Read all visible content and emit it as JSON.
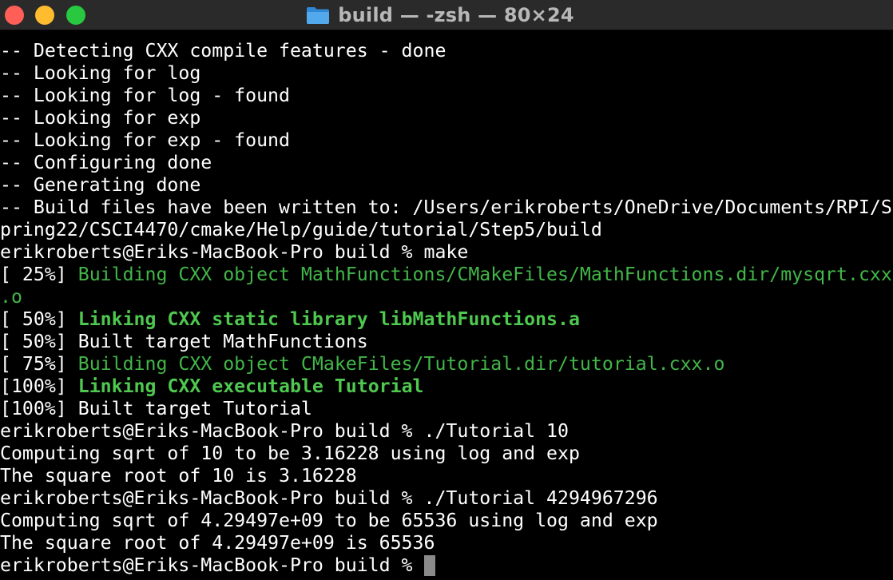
{
  "window": {
    "title": "build — -zsh — 80×24",
    "folder_icon": "folder-icon"
  },
  "colors": {
    "close": "#ff5f57",
    "minimize": "#febc2e",
    "zoom": "#28c840",
    "green": "#42b648",
    "background": "#000000",
    "text": "#ffffff"
  },
  "terminal": {
    "lines": [
      {
        "segments": [
          {
            "text": "-- Detecting CXX compile features - done",
            "style": "normal"
          }
        ]
      },
      {
        "segments": [
          {
            "text": "-- Looking for log",
            "style": "normal"
          }
        ]
      },
      {
        "segments": [
          {
            "text": "-- Looking for log - found",
            "style": "normal"
          }
        ]
      },
      {
        "segments": [
          {
            "text": "-- Looking for exp",
            "style": "normal"
          }
        ]
      },
      {
        "segments": [
          {
            "text": "-- Looking for exp - found",
            "style": "normal"
          }
        ]
      },
      {
        "segments": [
          {
            "text": "-- Configuring done",
            "style": "normal"
          }
        ]
      },
      {
        "segments": [
          {
            "text": "-- Generating done",
            "style": "normal"
          }
        ]
      },
      {
        "segments": [
          {
            "text": "-- Build files have been written to: /Users/erikroberts/OneDrive/Documents/RPI/S",
            "style": "normal"
          }
        ]
      },
      {
        "segments": [
          {
            "text": "pring22/CSCI4470/cmake/Help/guide/tutorial/Step5/build",
            "style": "normal"
          }
        ]
      },
      {
        "segments": [
          {
            "text": "erikroberts@Eriks-MacBook-Pro build % make",
            "style": "normal"
          }
        ]
      },
      {
        "segments": [
          {
            "text": "[ 25%] ",
            "style": "normal"
          },
          {
            "text": "Building CXX object MathFunctions/CMakeFiles/MathFunctions.dir/mysqrt.cxx",
            "style": "green"
          }
        ]
      },
      {
        "segments": [
          {
            "text": ".o",
            "style": "green"
          }
        ]
      },
      {
        "segments": [
          {
            "text": "[ 50%] ",
            "style": "normal"
          },
          {
            "text": "Linking CXX static library libMathFunctions.a",
            "style": "green-bold"
          }
        ]
      },
      {
        "segments": [
          {
            "text": "[ 50%] Built target MathFunctions",
            "style": "normal"
          }
        ]
      },
      {
        "segments": [
          {
            "text": "[ 75%] ",
            "style": "normal"
          },
          {
            "text": "Building CXX object CMakeFiles/Tutorial.dir/tutorial.cxx.o",
            "style": "green"
          }
        ]
      },
      {
        "segments": [
          {
            "text": "[100%] ",
            "style": "normal"
          },
          {
            "text": "Linking CXX executable Tutorial",
            "style": "green-bold"
          }
        ]
      },
      {
        "segments": [
          {
            "text": "[100%] Built target Tutorial",
            "style": "normal"
          }
        ]
      },
      {
        "segments": [
          {
            "text": "erikroberts@Eriks-MacBook-Pro build % ./Tutorial 10",
            "style": "normal"
          }
        ]
      },
      {
        "segments": [
          {
            "text": "Computing sqrt of 10 to be 3.16228 using log and exp",
            "style": "normal"
          }
        ]
      },
      {
        "segments": [
          {
            "text": "The square root of 10 is 3.16228",
            "style": "normal"
          }
        ]
      },
      {
        "segments": [
          {
            "text": "erikroberts@Eriks-MacBook-Pro build % ./Tutorial 4294967296",
            "style": "normal"
          }
        ]
      },
      {
        "segments": [
          {
            "text": "Computing sqrt of 4.29497e+09 to be 65536 using log and exp",
            "style": "normal"
          }
        ]
      },
      {
        "segments": [
          {
            "text": "The square root of 4.29497e+09 is 65536",
            "style": "normal"
          }
        ]
      },
      {
        "segments": [
          {
            "text": "erikroberts@Eriks-MacBook-Pro build % ",
            "style": "normal"
          }
        ],
        "cursor": true
      }
    ]
  }
}
